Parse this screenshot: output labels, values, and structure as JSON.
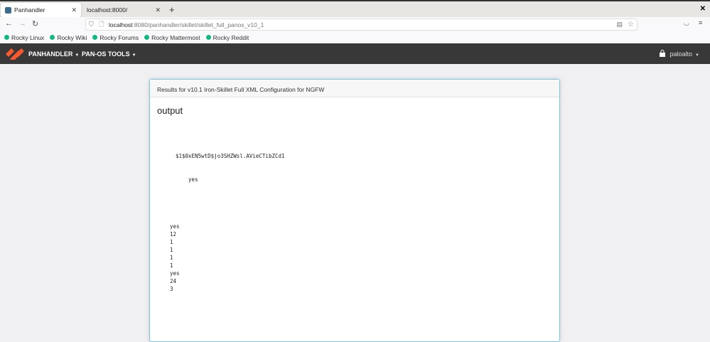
{
  "browser": {
    "tabs": [
      {
        "label": "Panhandler",
        "active": true
      },
      {
        "label": "localhost:8000/",
        "active": false
      }
    ],
    "url_host": "localhost",
    "url_rest": ":8080/panhandler/skillet/skillet_full_panos_v10_1",
    "bookmarks": [
      "Rocky Linux",
      "Rocky Wiki",
      "Rocky Forums",
      "Rocky Mattermost",
      "Rocky Reddit"
    ]
  },
  "app": {
    "menus": [
      "PANHANDLER",
      "PAN-OS TOOLS"
    ],
    "user": "paloalto",
    "brand_color": "#fa582d"
  },
  "card": {
    "header": "Results for v10.1 Iron-Skillet Full XML Configuration for NGFW",
    "title": "output",
    "lines": [
      "$1$0xEN5wtD$jo3SHZWsl.AVieCTibZCd1",
      "yes",
      "yes",
      "12",
      "1",
      "1",
      "1",
      "1",
      "yes",
      "24",
      "3"
    ]
  }
}
